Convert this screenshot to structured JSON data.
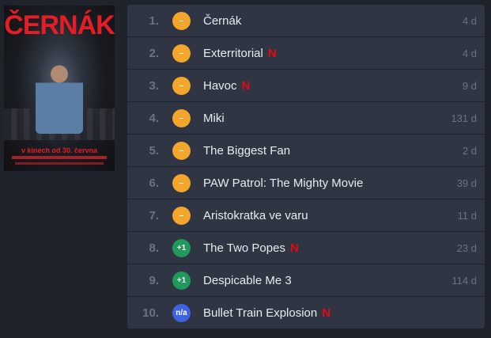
{
  "poster": {
    "title": "ČERNÁK",
    "tagline": "v kinech od 30. června",
    "alt": "Černák poster"
  },
  "colors": {
    "badge_neutral": "#f3a52c",
    "badge_up": "#1f9a5c",
    "badge_na": "#3f63e0",
    "netflix": "#e50914"
  },
  "rows": [
    {
      "rank": "1.",
      "badge": "–",
      "badge_type": "neutral",
      "title": "Černák",
      "netflix": false,
      "days": "4 d"
    },
    {
      "rank": "2.",
      "badge": "–",
      "badge_type": "neutral",
      "title": "Exterritorial",
      "netflix": true,
      "days": "4 d"
    },
    {
      "rank": "3.",
      "badge": "–",
      "badge_type": "neutral",
      "title": "Havoc",
      "netflix": true,
      "days": "9 d"
    },
    {
      "rank": "4.",
      "badge": "–",
      "badge_type": "neutral",
      "title": "Miki",
      "netflix": false,
      "days": "131 d"
    },
    {
      "rank": "5.",
      "badge": "–",
      "badge_type": "neutral",
      "title": "The Biggest Fan",
      "netflix": false,
      "days": "2 d"
    },
    {
      "rank": "6.",
      "badge": "–",
      "badge_type": "neutral",
      "title": "PAW Patrol: The Mighty Movie",
      "netflix": false,
      "days": "39 d"
    },
    {
      "rank": "7.",
      "badge": "–",
      "badge_type": "neutral",
      "title": "Aristokratka ve varu",
      "netflix": false,
      "days": "11 d"
    },
    {
      "rank": "8.",
      "badge": "+1",
      "badge_type": "up",
      "title": "The Two Popes",
      "netflix": true,
      "days": "23 d"
    },
    {
      "rank": "9.",
      "badge": "+1",
      "badge_type": "up",
      "title": "Despicable Me 3",
      "netflix": false,
      "days": "114 d"
    },
    {
      "rank": "10.",
      "badge": "n/a",
      "badge_type": "na",
      "title": "Bullet Train Explosion",
      "netflix": true,
      "days": ""
    }
  ],
  "netflix_glyph": "N"
}
